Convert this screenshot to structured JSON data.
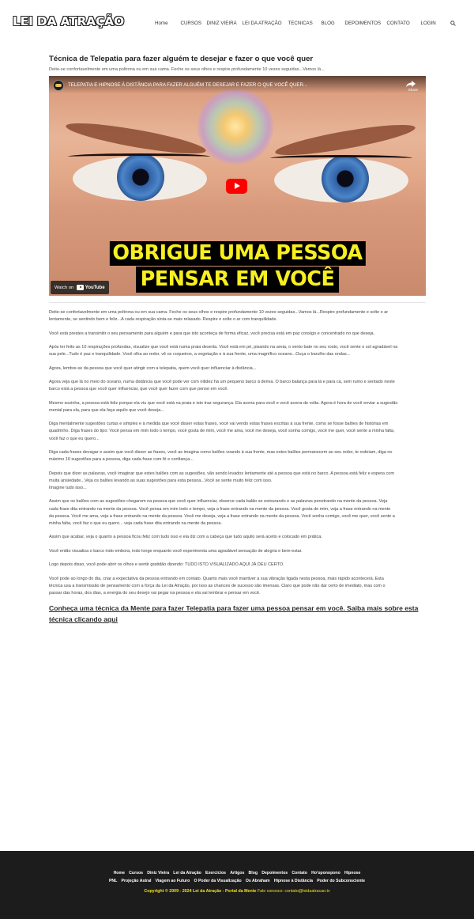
{
  "header": {
    "logo": "LEI DA ATRAÇÃO",
    "nav": [
      "Home",
      "CURSOS",
      "DINIZ VIEIRA",
      "LEI DA ATRAÇÃO",
      "TECNICAS",
      "BLOG",
      "DEPOIMENTOS",
      "CONTATO",
      "LOGIN"
    ],
    "search_icon": "search-icon"
  },
  "main": {
    "title": "Técnica de Telepatia para fazer alguém te desejar e fazer o que você quer",
    "subtitle": "Deite-se confortavelmente em uma poltrona ou em sua cama. Feche os seus olhos e respire profundamente 10 vezes seguidas...Vamos lá...",
    "video": {
      "title": "TELEPATIA E HIPNOSE À DISTÂNCIA PARA FAZER ALGUÉM TE DESEJAR E FAZER O QUE VOCÊ QUER...",
      "share_label": "Share",
      "banner_line1": "OBRIGUE UMA PESSOA",
      "banner_line2": "PENSAR EM VOCÊ",
      "watch_on": "Watch on",
      "youtube": "YouTube"
    },
    "paragraphs": [
      [
        "Deite-se confortavelmente em uma poltrona ou em sua cama. Feche os seus olhos e respire profundamente 10 vezes seguidas...Vamos lá...Respire profundamente e solte o ar",
        "lentamente, se sentindo bem e feliz...A cada respiração sinta-se mais relaxado. Respire e solte o ar com tranquilidade."
      ],
      [
        "Você está prestes a transmitir o seu pensamento para alguém e para que isto aconteça de forma eficaz, você precisa está em paz consigo e concentrado no que deseja."
      ],
      [
        "Após ter feito as 10 respirações profundas, visualize que você está numa praia deserta. Você está em pé, pisando na areia, o vento bate no seu rosto, você sente o sol agradável na",
        "sua pele...Tudo é paz e tranquilidade. Você olha ao redor, vê os coqueiros, a vegetação e à sua frente, uma magnífico oceano...Ouça o barulho das ondas..."
      ],
      [
        "Agora, lembre-se da pessoa que você quer atingir com a telepatia, quem você quer influenciar à distância..."
      ],
      [
        "Agora veja que lá no meio do oceano, numa distância que você pode ver com nitidez há um pequeno barco à deriva. O barco balança para lá e para cá, sem rumo e sentado neste",
        "barco está a pessoa que você quer influenciar, que você quer fazer com que pense em você."
      ],
      [
        "Mesmo sozinha, a pessoa está feliz porque ela viu que você está na praia e isto traz segurança. Ela acena para você e você acena de volta. Agora é hora de você enviar a sugestão",
        "mental para ela, para que ela faça aquilo que você deseja..."
      ],
      [
        "Diga mentalmente sugestões curtas e simples e à medida que você disser estas frases, você vai vendo estas frases escritas à sua frente, como se fosse balões de histórias em",
        "quadrinho. Diga frases do tipo: Você pensa em mim todo o tempo, você gosta de mim, você me ama, você me deseja, você sonha comigo, você me quer, você sente a minha falta,",
        "você faz o que eu quero..."
      ],
      [
        "Diga cada frases devagar e assim que você disser as frases, você as imagina como balões voando à sua frente, mas estes balões permanecem ao seu redor, te rodeiam, diga no",
        "máximo 10 sugestões para a pessoa, diga cada frase com fé e confiança..."
      ],
      [
        "Depois que dizer as palavras, você imaginar que estes balões com as sugestões, vão sendo levados lentamente até a pessoa que está no barco. A pessoa está feliz e espera com",
        "muita ansiedade...Veja os balões levando as suas sugestões para esta pessoa...Você se sente muito feliz com isso.",
        "Imagine tudo isso..."
      ],
      [
        "Assim que os balões com as sugestões chegarem na pessoa que você quer influenciar, observe cada balão se estourando e as palavras penetrando na mente da pessoa. Veja",
        "cada frase dita entrando na mente da pessoa. Você pensa em mim todo o tempo, veja a frase entrando na mente da pessoa. Você gosta de mim, veja a frase entrando na mente",
        "da pessoa. Você me ama, veja a frase entrando na mente da pessoa. Você me deseja, veja a frase entrando na mente da pessoa. Você sonha comigo, você me quer, você sente a",
        "minha falta, você faz o que eu quero... veja cada frase dita entrando na mente da pessoa."
      ],
      [
        "Assim que acabar, veja o quanto a pessoa ficou feliz com tudo isso e ela diz com a cabeça que tudo aquilo será aceito e colocado em prática."
      ],
      [
        "Você então visualiza o barco indo embora, indo longe enquanto você experimenta uma agradável sensação de alegria e bem-estar."
      ],
      [
        "Logo depois disso, você pode abrir os olhos e sentir gratidão dizendo: TUDO ISTO VISUALIZADO AQUI JÁ DEU CERTO."
      ],
      [
        "Você pode ao longo do dia, criar a expectativa da pessoa entrando em contato. Quanto mais você mantiver a sua vibração ligada nesta pessoa, mais rápido acontecerá. Esta",
        "técnica usa a transmissão de pensamento com a força da Lei da Atração, por isso as chances de sucesso são imensas. Claro que pode não dar certo de imediato, mas com o",
        "passar das horas, dos dias, a energia do seu desejo vai pegar na pessoa e ela vai lembrar e pensar em você."
      ]
    ],
    "cta_line1": "Conheça uma técnica da Mente para fazer Telepatia para fazer uma pessoa pensar em você. Saiba mais sobre esta",
    "cta_line2": "técnica clicando aqui"
  },
  "footer": {
    "links_row1": [
      "Home",
      "Cursos",
      "Diniz Vieira",
      "Lei da Atração",
      "Exercícios",
      "Artigos",
      "Blog",
      "Depoimentos",
      "Contato",
      "Ho'oponopono",
      "Hipnose"
    ],
    "links_row2": [
      "PNL",
      "Projeção Astral",
      "Viagem ao Futuro",
      "O Poder da Visualização",
      "Os Abraham",
      "Hipnose à Distância",
      "Poder do Subconsciente"
    ],
    "copyright": "Copyright © 2009 - 2024 Lei da Atração - Portal da Mente",
    "contact": "Fale conosco: contato@leidaatracao.tv"
  },
  "colors": {
    "banner_text": "#f7ef1f",
    "play_button": "#ff0000",
    "footer_bg": "#1c1c1c",
    "footer_copyright": "#f0e020"
  }
}
